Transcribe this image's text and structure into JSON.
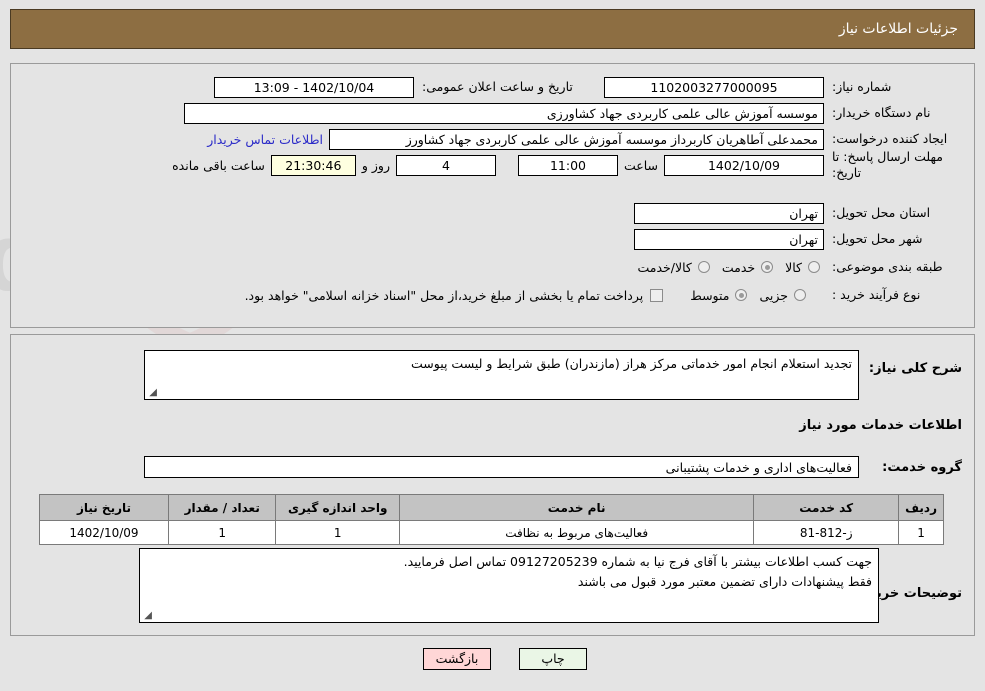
{
  "header": {
    "title": "جزئیات اطلاعات نیاز"
  },
  "top": {
    "need_number_label": "شماره نیاز:",
    "need_number_value": "1102003277000095",
    "announce_label": "تاریخ و ساعت اعلان عمومی:",
    "announce_value": "1402/10/04 - 13:09",
    "buyer_org_label": "نام دستگاه خریدار:",
    "buyer_org_value": "موسسه آموزش عالی علمی کاربردی جهاد کشاورزی",
    "creator_label": "ایجاد کننده درخواست:",
    "creator_value": "محمدعلی آطاهریان کاربرداز موسسه آموزش عالی علمی کاربردی جهاد کشاورز",
    "contact_link": "اطلاعات تماس خریدار",
    "deadline_label": "مهلت ارسال پاسخ: تا تاریخ:",
    "deadline_date": "1402/10/09",
    "hour_label": "ساعت",
    "hour_value": "11:00",
    "days_value": "4",
    "days_sep": "روز و",
    "timer_value": "21:30:46",
    "timer_suffix": "ساعت باقی مانده",
    "province_label": "استان محل تحویل:",
    "province_value": "تهران",
    "city_label": "شهر محل تحویل:",
    "city_value": "تهران",
    "category_label": "طبقه بندی موضوعی:",
    "category_options": [
      {
        "label": "کالا",
        "selected": false
      },
      {
        "label": "خدمت",
        "selected": true
      },
      {
        "label": "کالا/خدمت",
        "selected": false
      }
    ],
    "process_label": "نوع فرآیند خرید :",
    "process_options": [
      {
        "label": "جزیی",
        "selected": false
      },
      {
        "label": "متوسط",
        "selected": true
      }
    ],
    "treasury_checkbox_checked": false,
    "treasury_text": "پرداخت تمام یا بخشی از مبلغ خرید،از محل \"اسناد خزانه اسلامی\" خواهد بود."
  },
  "bottom": {
    "summary_label": "شرح کلی نیاز:",
    "summary_value": "تجدید استعلام انجام امور خدماتی مرکز هراز (مازندران) طبق شرایط و لیست پیوست",
    "services_heading": "اطلاعات خدمات مورد نیاز",
    "service_group_label": "گروه خدمت:",
    "service_group_value": "فعالیت‌های اداری و خدمات پشتیبانی",
    "table": {
      "columns": [
        "ردیف",
        "کد خدمت",
        "نام خدمت",
        "واحد اندازه گیری",
        "تعداد / مقدار",
        "تاریخ نیاز"
      ],
      "rows": [
        [
          "1",
          "ز-812-81",
          "فعالیت‌های مربوط به نظافت",
          "1",
          "1",
          "1402/10/09"
        ]
      ]
    },
    "buyer_notes_label": "توضیحات خریدار:",
    "buyer_notes_lines": [
      "جهت کسب اطلاعات بیشتر با آقای فرج نیا به شماره 09127205239 تماس اصل فرمایید.",
      "فقط پیشنهادات دارای تضمین معتبر مورد قبول می باشند"
    ]
  },
  "footer": {
    "print_label": "چاپ",
    "back_label": "بازگشت"
  },
  "colors": {
    "header_bg": "#8d6e42",
    "page_bg": "#e4e4e4",
    "link": "#2b2bc8",
    "print_btn": "#eaf6e6",
    "back_btn": "#ffd6d6",
    "timer_bg": "#feffe0"
  },
  "watermark": {
    "text": "AriaTender.net"
  }
}
